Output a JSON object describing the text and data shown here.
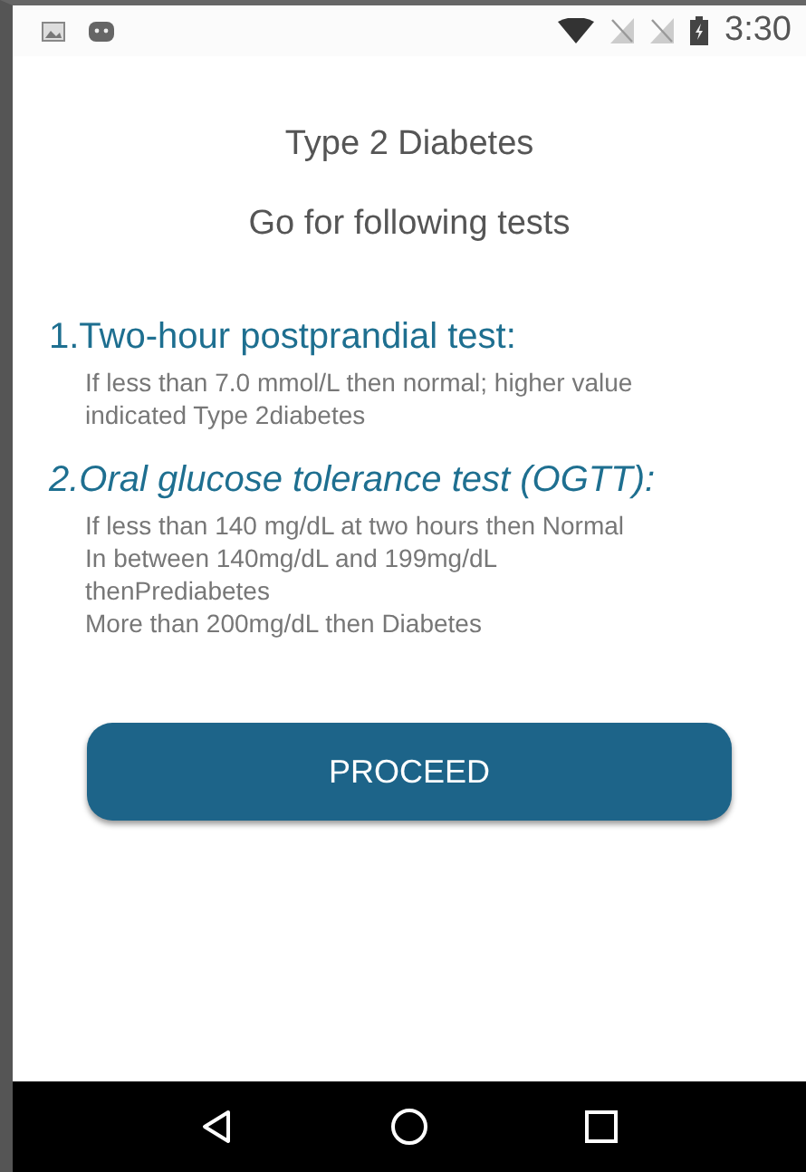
{
  "status_bar": {
    "time": "3:30"
  },
  "title": "Type 2 Diabetes",
  "subtitle": "Go for following tests",
  "tests": [
    {
      "heading": "1.Two-hour postprandial test:",
      "italic": false,
      "lines": [
        "If less than 7.0 mmol/L then normal; higher value",
        "indicated Type 2diabetes"
      ]
    },
    {
      "heading": "2.Oral glucose tolerance test (OGTT):",
      "italic": true,
      "lines": [
        "If less than 140 mg/dL at two hours then Normal",
        "In between 140mg/dL and 199mg/dL",
        "thenPrediabetes",
        "More than 200mg/dL then Diabetes"
      ]
    }
  ],
  "button": "PROCEED"
}
